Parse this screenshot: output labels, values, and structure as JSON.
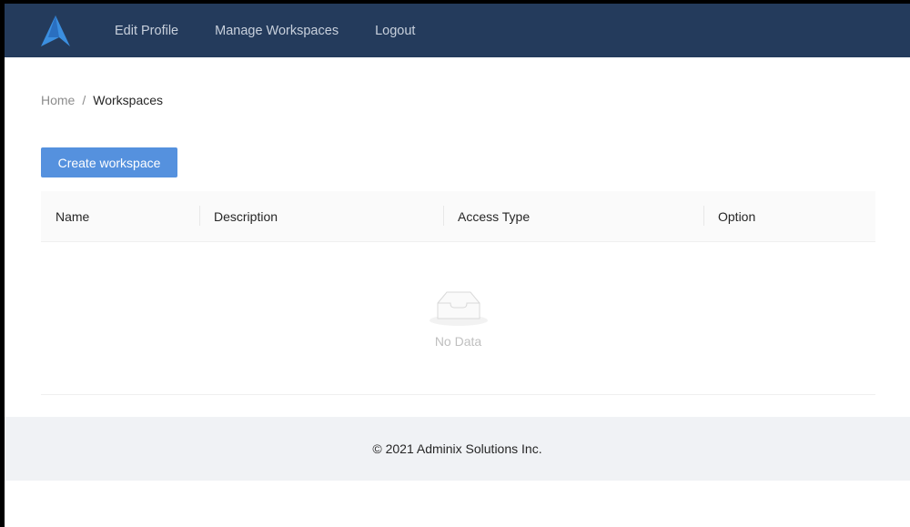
{
  "nav": {
    "items": [
      "Edit Profile",
      "Manage Workspaces",
      "Logout"
    ]
  },
  "breadcrumb": {
    "home": "Home",
    "separator": "/",
    "current": "Workspaces"
  },
  "create_button": "Create workspace",
  "table": {
    "columns": [
      "Name",
      "Description",
      "Access Type",
      "Option"
    ],
    "empty_text": "No Data"
  },
  "footer": "© 2021 Adminix Solutions Inc.",
  "colors": {
    "nav": "#243b5c",
    "primary": "#5591de"
  }
}
